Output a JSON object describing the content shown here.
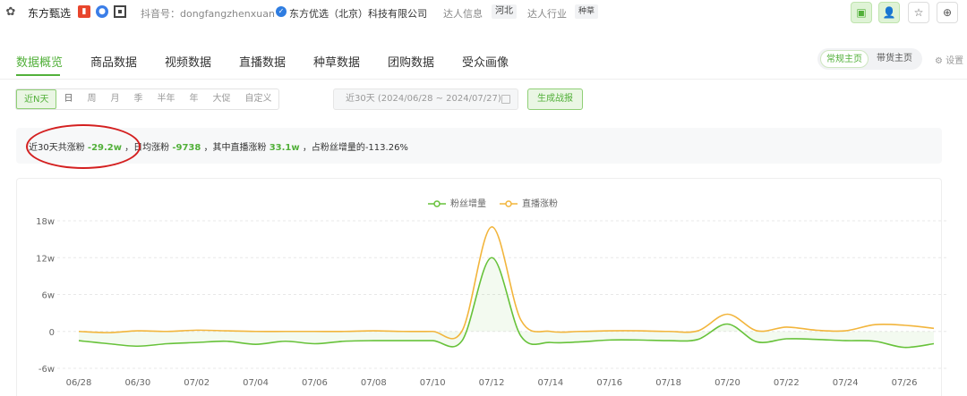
{
  "topbar": {
    "account_name": "东方甄选",
    "red_badge_icon": "bar-chart-icon",
    "douyin_id": "抖音号：dongfangzhenxuan",
    "company": "东方优选（北京）科技有限公司",
    "daren_info_label": "达人信息",
    "region": "河北",
    "daren_industry_label": "达人行业",
    "industry": "种草",
    "colors": {
      "accent": "#52b03a",
      "red": "#e8452c",
      "blue": "#2f7de1"
    }
  },
  "tabs": [
    {
      "label": "数据概览",
      "active": true
    },
    {
      "label": "商品数据"
    },
    {
      "label": "视频数据"
    },
    {
      "label": "直播数据"
    },
    {
      "label": "种草数据"
    },
    {
      "label": "团购数据"
    },
    {
      "label": "受众画像"
    }
  ],
  "mode_switch": {
    "regular": "常规主页",
    "selling": "带货主页"
  },
  "settings_label": "设置",
  "filters": {
    "ranges": [
      "近N天",
      "日",
      "周",
      "月",
      "季",
      "半年",
      "年",
      "大促",
      "自定义"
    ],
    "date_range": "近30天 (2024/06/28 ~ 2024/07/27)",
    "generate_label": "生成战报"
  },
  "summary": {
    "p1": "近30天共涨粉",
    "v1": "-29.2w",
    "p2": "，日均涨粉",
    "v2": "-9738",
    "p3": "，其中直播涨粉",
    "v3": "33.1w",
    "p4": "，占粉丝增量的-113.26%"
  },
  "chart_data": {
    "type": "line",
    "legend_position": "top-center",
    "ylim": [
      -6,
      18
    ],
    "yticks": [
      "-6w",
      "0",
      "6w",
      "12w",
      "18w"
    ],
    "ytick_values": [
      -6,
      0,
      6,
      12,
      18
    ],
    "grid": true,
    "x": [
      "06/28",
      "06/29",
      "06/30",
      "07/01",
      "07/02",
      "07/03",
      "07/04",
      "07/05",
      "07/06",
      "07/07",
      "07/08",
      "07/09",
      "07/10",
      "07/11",
      "07/12",
      "07/13",
      "07/14",
      "07/15",
      "07/16",
      "07/17",
      "07/18",
      "07/19",
      "07/20",
      "07/21",
      "07/22",
      "07/23",
      "07/24",
      "07/25",
      "07/26",
      "07/27"
    ],
    "xticks": [
      "06/28",
      "06/30",
      "07/02",
      "07/04",
      "07/06",
      "07/08",
      "07/10",
      "07/12",
      "07/14",
      "07/16",
      "07/18",
      "07/20",
      "07/22",
      "07/24",
      "07/26"
    ],
    "series": [
      {
        "name": "粉丝增量",
        "color": "#67c23a",
        "values": [
          -1.5,
          -2.0,
          -2.4,
          -2.0,
          -1.8,
          -1.6,
          -2.1,
          -1.6,
          -2.0,
          -1.6,
          -1.5,
          -1.5,
          -1.5,
          -1.5,
          12.0,
          -0.8,
          -1.8,
          -1.7,
          -1.4,
          -1.4,
          -1.5,
          -1.3,
          1.2,
          -1.7,
          -1.2,
          -1.3,
          -1.5,
          -1.6,
          -2.6,
          -2.0
        ]
      },
      {
        "name": "直播涨粉",
        "color": "#f2b53c",
        "values": [
          0.0,
          -0.2,
          0.1,
          0.0,
          0.2,
          0.1,
          0.0,
          0.0,
          0.0,
          0.0,
          0.1,
          0.0,
          0.0,
          0.1,
          17.0,
          1.8,
          0.0,
          0.0,
          0.1,
          0.1,
          0.0,
          0.1,
          2.8,
          0.1,
          0.7,
          0.2,
          0.1,
          1.1,
          1.0,
          0.5
        ]
      }
    ]
  }
}
